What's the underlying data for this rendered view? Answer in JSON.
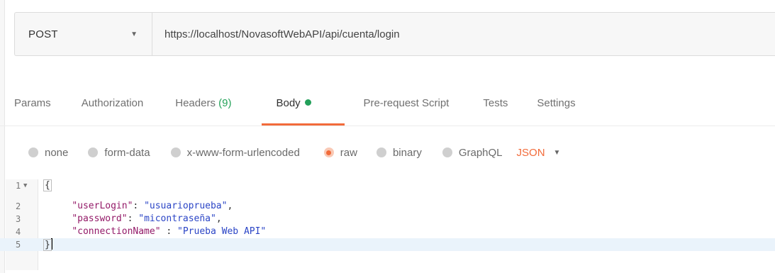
{
  "request": {
    "method": "POST",
    "url": "https://localhost/NovasoftWebAPI/api/cuenta/login"
  },
  "tabs": [
    {
      "label": "Params"
    },
    {
      "label": "Authorization"
    },
    {
      "label": "Headers",
      "count": "(9)"
    },
    {
      "label": "Body",
      "active": true,
      "indicator": "green-dot"
    },
    {
      "label": "Pre-request Script"
    },
    {
      "label": "Tests"
    },
    {
      "label": "Settings"
    }
  ],
  "body_modes": [
    {
      "label": "none"
    },
    {
      "label": "form-data"
    },
    {
      "label": "x-www-form-urlencoded"
    },
    {
      "label": "raw",
      "selected": true
    },
    {
      "label": "binary"
    },
    {
      "label": "GraphQL"
    }
  ],
  "format": "JSON",
  "editor": {
    "line_numbers": [
      "1",
      "2",
      "3",
      "4",
      "5"
    ],
    "open_brace": "{",
    "close_brace": "}",
    "fields": [
      {
        "key": "\"userLogin\"",
        "sep": ": ",
        "value": "\"usuarioprueba\"",
        "trail": ","
      },
      {
        "key": "\"password\"",
        "sep": ": ",
        "value": "\"micontraseña\"",
        "trail": ","
      },
      {
        "key": "\"connectionName\"",
        "sep": " : ",
        "value": "\"Prueba Web API\"",
        "trail": ""
      }
    ]
  },
  "colors": {
    "accent": "#f26b3a",
    "active_dot": "#23a05a",
    "json_key": "#931a68",
    "json_string": "#2b45c6"
  }
}
